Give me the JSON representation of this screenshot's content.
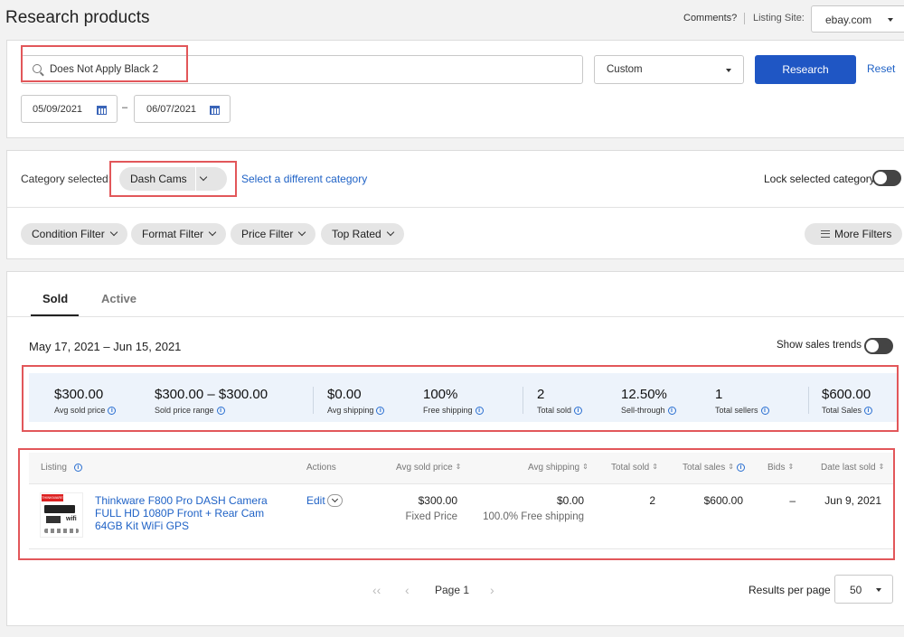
{
  "header": {
    "title": "Research products",
    "comments_link": "Comments?",
    "listing_site_label": "Listing Site:",
    "listing_site_value": "ebay.com"
  },
  "search": {
    "value": "Does Not Apply Black 2",
    "period_value": "Custom",
    "research_button": "Research",
    "reset_link": "Reset",
    "date_from": "05/09/2021",
    "date_sep": "–",
    "date_to": "06/07/2021"
  },
  "category": {
    "label": "Category selected:",
    "selected": "Dash Cams",
    "change_link": "Select a different category",
    "lock_label": "Lock selected category"
  },
  "filters": {
    "items": [
      "Condition Filter",
      "Format Filter",
      "Price Filter",
      "Top Rated"
    ],
    "more": "More Filters"
  },
  "tabs": {
    "sold": "Sold",
    "active": "Active"
  },
  "results": {
    "date_range": "May 17, 2021 – Jun 15, 2021",
    "trends_label": "Show sales trends"
  },
  "stats": [
    {
      "value": "$300.00",
      "label": "Avg sold price"
    },
    {
      "value": "$300.00 – $300.00",
      "label": "Sold price range"
    },
    {
      "value": "$0.00",
      "label": "Avg shipping"
    },
    {
      "value": "100%",
      "label": "Free shipping"
    },
    {
      "value": "2",
      "label": "Total sold"
    },
    {
      "value": "12.50%",
      "label": "Sell-through"
    },
    {
      "value": "1",
      "label": "Total sellers"
    },
    {
      "value": "$600.00",
      "label": "Total Sales"
    }
  ],
  "table": {
    "headers": {
      "listing": "Listing",
      "actions": "Actions",
      "avg_sold_price": "Avg sold price",
      "avg_shipping": "Avg shipping",
      "total_sold": "Total sold",
      "total_sales": "Total sales",
      "bids": "Bids",
      "date_last_sold": "Date last sold"
    },
    "rows": [
      {
        "title": "Thinkware F800 Pro DASH Camera FULL HD 1080P Front + Rear Cam 64GB Kit WiFi GPS",
        "action": "Edit",
        "avg_sold_price": "$300.00",
        "format": "Fixed Price",
        "avg_shipping": "$0.00",
        "free_shipping": "100.0% Free shipping",
        "total_sold": "2",
        "total_sales": "$600.00",
        "bids": "–",
        "date_last_sold": "Jun 9, 2021",
        "thumb_brand": "THINKWARE",
        "thumb_wifi": "wifi"
      }
    ]
  },
  "pagination": {
    "page_label": "Page 1",
    "per_page_label": "Results per page",
    "per_page_value": "50"
  },
  "colors": {
    "primary": "#1f56c4",
    "link": "#1f62c6",
    "highlight": "#e2575a",
    "stats_bg": "#edf3fb"
  }
}
